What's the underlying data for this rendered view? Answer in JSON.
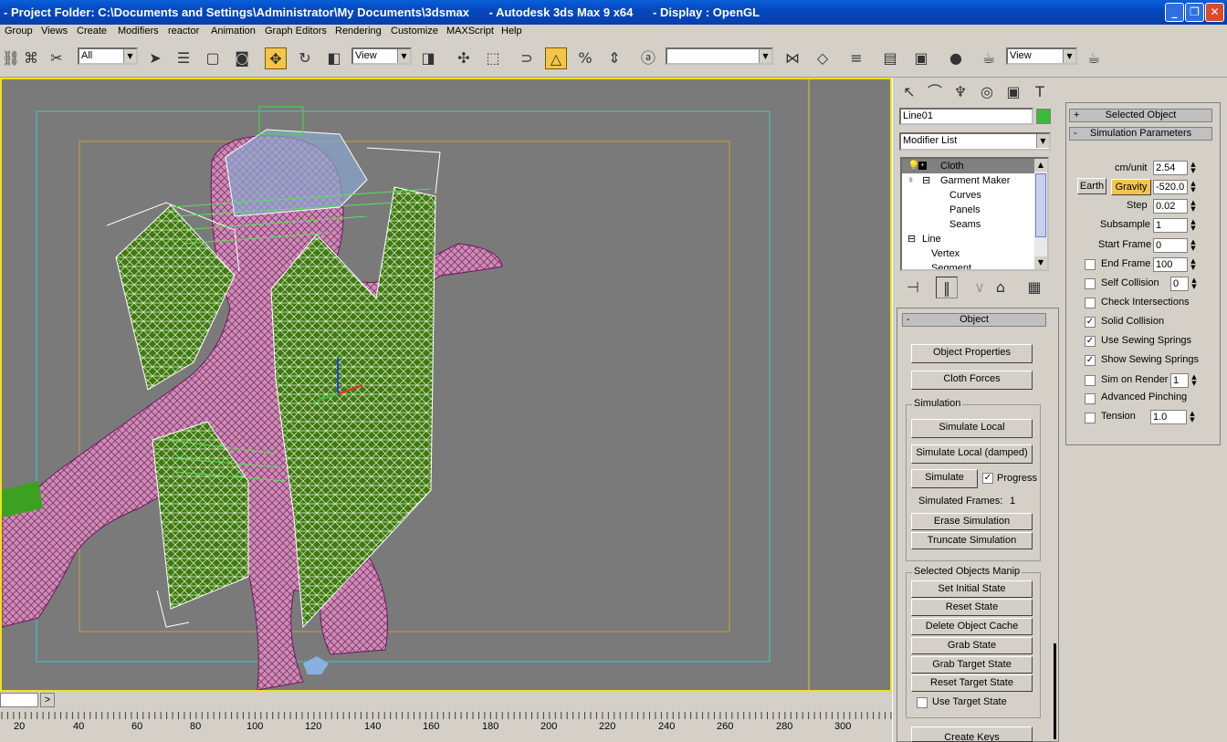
{
  "window": {
    "title": "- Project Folder: C:\\Documents and Settings\\Administrator\\My Documents\\3dsmax      - Autodesk 3ds Max 9 x64      - Display : OpenGL",
    "buttons": [
      "_",
      "❐",
      "✕"
    ]
  },
  "menu": [
    "Group",
    "Views",
    "Create",
    "Modifiers",
    "reactor",
    "Animation",
    "Graph Editors",
    "Rendering",
    "Customize",
    "MAXScript",
    "Help"
  ],
  "toolbar": {
    "selection_filter": "All",
    "ref_coord": "View",
    "named_selection": "",
    "render_view": "View"
  },
  "timeline": {
    "ticks": [
      "20",
      "40",
      "60",
      "80",
      "100",
      "120",
      "140",
      "160",
      "180",
      "200",
      "220",
      "240",
      "260",
      "280",
      "300"
    ],
    "arrow": ">"
  },
  "command_panel": {
    "object_name": "Line01",
    "object_color": "#3cb83c",
    "modifier_list": "Modifier List",
    "stack": [
      {
        "label": "Cloth",
        "selected": true
      },
      {
        "label": "Garment Maker"
      },
      {
        "label": "Curves"
      },
      {
        "label": "Panels"
      },
      {
        "label": "Seams"
      },
      {
        "label": "Line"
      },
      {
        "label": "Vertex"
      },
      {
        "label": "Segment"
      }
    ],
    "object_rollout": {
      "title": "Object",
      "sign": "-",
      "object_properties": "Object Properties",
      "cloth_forces": "Cloth Forces",
      "simulation_group": "Simulation",
      "simulate_local": "Simulate Local",
      "simulate_local_damped": "Simulate Local (damped)",
      "simulate": "Simulate",
      "progress": "Progress",
      "simulated_frames_label": "Simulated Frames:",
      "simulated_frames_value": "1",
      "erase_simulation": "Erase Simulation",
      "truncate_simulation": "Truncate Simulation",
      "manip_group": "Selected Objects Manip",
      "set_initial_state": "Set Initial State",
      "reset_state": "Reset State",
      "delete_object_cache": "Delete Object Cache",
      "grab_state": "Grab State",
      "grab_target_state": "Grab Target State",
      "reset_target_state": "Reset Target State",
      "use_target_state": "Use Target State",
      "create_keys": "Create Keys"
    }
  },
  "sim_panel": {
    "selected_object": "Selected Object",
    "selected_object_sign": "+",
    "sim_params": "Simulation Parameters",
    "sim_params_sign": "-",
    "cm_unit_label": "cm/unit",
    "cm_unit": "2.54",
    "earth": "Earth",
    "gravity": "Gravity",
    "gravity_value": "-520.0",
    "step_label": "Step",
    "step": "0.02",
    "subsample_label": "Subsample",
    "subsample": "1",
    "start_frame_label": "Start Frame",
    "start_frame": "0",
    "end_frame_label": "End Frame",
    "end_frame": "100",
    "self_collision_label": "Self Collision",
    "self_collision": "0",
    "check_intersections": "Check Intersections",
    "solid_collision": "Solid Collision",
    "use_sewing_springs": "Use Sewing Springs",
    "show_sewing_springs": "Show Sewing Springs",
    "sim_on_render_label": "Sim on Render",
    "sim_on_render": "1",
    "advanced_pinching": "Advanced Pinching",
    "tension_label": "Tension",
    "tension": "1.0"
  }
}
